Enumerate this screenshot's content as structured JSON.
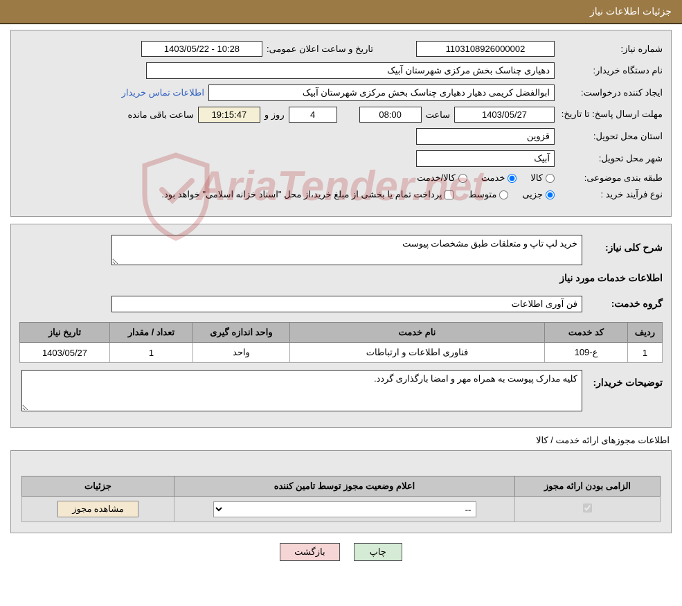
{
  "header": {
    "title": "جزئیات اطلاعات نیاز"
  },
  "info": {
    "need_no_label": "شماره نیاز:",
    "need_no": "1103108926000002",
    "announce_label": "تاریخ و ساعت اعلان عمومی:",
    "announce_value": "1403/05/22 - 10:28",
    "buyer_org_label": "نام دستگاه خریدار:",
    "buyer_org": "دهیاری چناسک بخش مرکزی شهرستان آبیک",
    "requester_label": "ایجاد کننده درخواست:",
    "requester": "ابوالفضل کریمی دهیار دهیاری چناسک بخش مرکزی شهرستان آبیک",
    "contact_link": "اطلاعات تماس خریدار",
    "deadline_label": "مهلت ارسال پاسخ:  تا تاریخ:",
    "deadline_date": "1403/05/27",
    "time_label": "ساعت",
    "deadline_time": "08:00",
    "days_value": "4",
    "days_label": "روز و",
    "remain_time": "19:15:47",
    "remain_label": "ساعت باقی مانده",
    "province_label": "استان محل تحویل:",
    "province": "قزوین",
    "city_label": "شهر محل تحویل:",
    "city": "آبیک",
    "category_label": "طبقه بندی موضوعی:",
    "opt_goods": "کالا",
    "opt_service": "خدمت",
    "opt_goods_service": "کالا/خدمت",
    "process_label": "نوع فرآیند خرید :",
    "opt_partial": "جزیی",
    "opt_medium": "متوسط",
    "payment_note": "پرداخت تمام یا بخشی از مبلغ خرید،از محل \"اسناد خزانه اسلامی\" خواهد بود."
  },
  "need": {
    "desc_label": "شرح کلی نیاز:",
    "desc": "خرید لپ تاپ و متعلقات طبق مشخصات پیوست",
    "services_title": "اطلاعات خدمات مورد نیاز",
    "group_label": "گروه خدمت:",
    "group": "فن آوری اطلاعات",
    "table": {
      "headers": {
        "row": "ردیف",
        "code": "کد خدمت",
        "name": "نام خدمت",
        "unit": "واحد اندازه گیری",
        "qty": "تعداد / مقدار",
        "date": "تاریخ نیاز"
      },
      "rows": [
        {
          "row": "1",
          "code": "ع-109",
          "name": "فناوری اطلاعات و ارتباطات",
          "unit": "واحد",
          "qty": "1",
          "date": "1403/05/27"
        }
      ]
    },
    "buyer_notes_label": "توضیحات خریدار:",
    "buyer_notes": "کلیه مدارک پیوست به همراه مهر و امضا بارگذاری گردد."
  },
  "license": {
    "section_title": "اطلاعات مجوزهای ارائه خدمت / کالا",
    "headers": {
      "mandatory": "الزامی بودن ارائه مجوز",
      "status": "اعلام وضعیت مجوز توسط تامین کننده",
      "details": "جزئیات"
    },
    "status_option": "--",
    "view_btn": "مشاهده مجوز"
  },
  "footer": {
    "print": "چاپ",
    "back": "بازگشت"
  },
  "watermark": "AriaTender.net"
}
